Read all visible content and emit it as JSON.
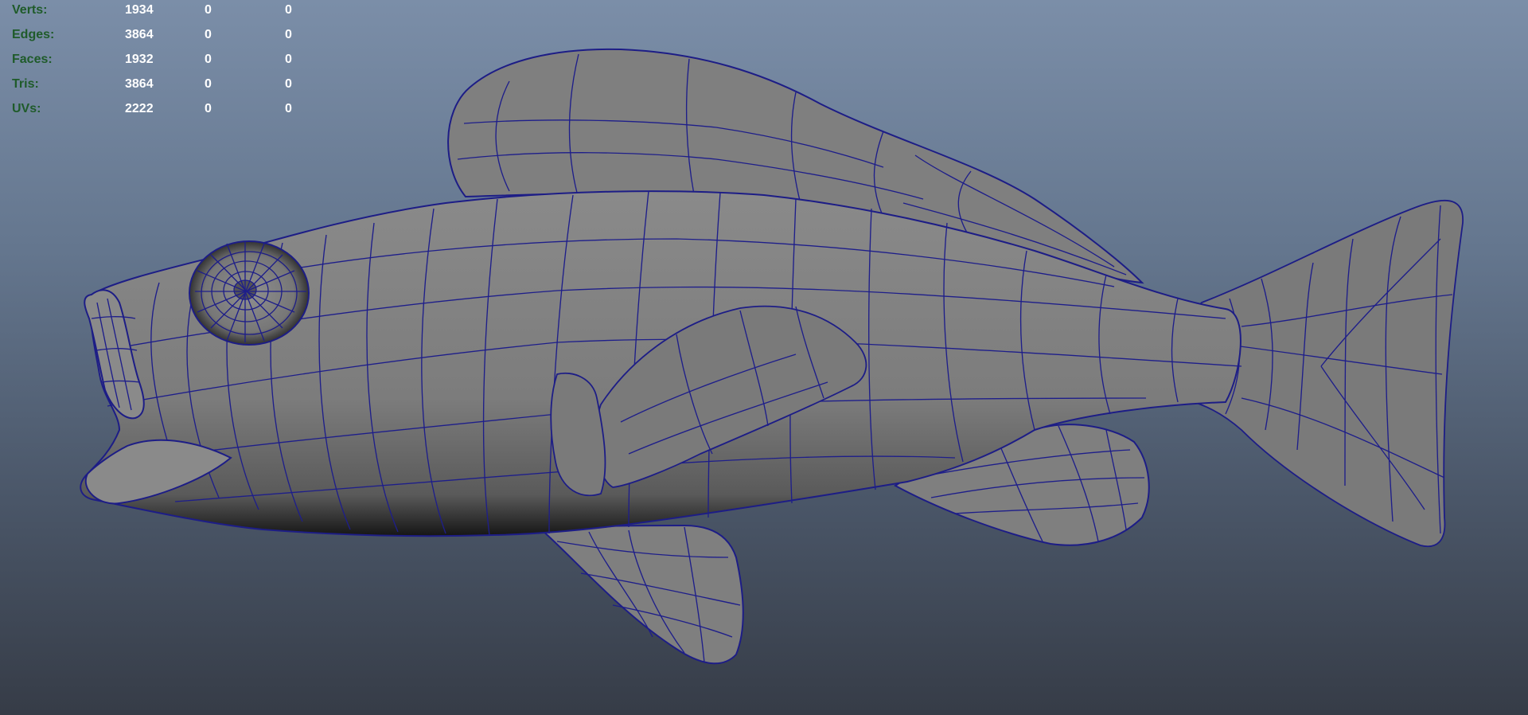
{
  "viewport": {
    "background_top": "#7b8ea8",
    "background_bottom": "#363c47",
    "wireframe_color": "#1e1e8a",
    "mesh_fill": "#7f7f7f",
    "hud_label_color": "#1f5b2a",
    "hud_value_color": "#ffffff"
  },
  "hud": {
    "rows": [
      {
        "label": "Verts:",
        "values": [
          "1934",
          "0",
          "0"
        ]
      },
      {
        "label": "Edges:",
        "values": [
          "3864",
          "0",
          "0"
        ]
      },
      {
        "label": "Faces:",
        "values": [
          "1932",
          "0",
          "0"
        ]
      },
      {
        "label": "Tris:",
        "values": [
          "3864",
          "0",
          "0"
        ]
      },
      {
        "label": "UVs:",
        "values": [
          "2222",
          "0",
          "0"
        ]
      }
    ]
  }
}
